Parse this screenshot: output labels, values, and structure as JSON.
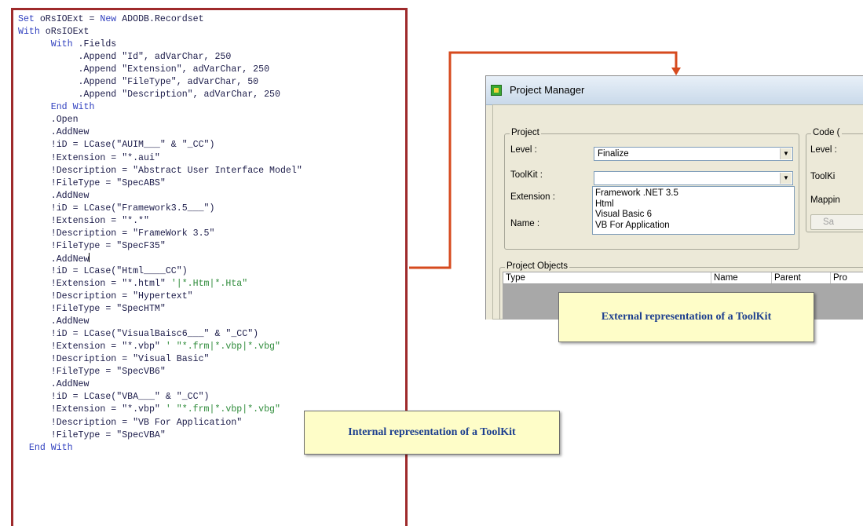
{
  "code": {
    "lines": [
      [
        {
          "t": "Set",
          "k": "kw"
        },
        {
          "t": " oRsIOExt = "
        },
        {
          "t": "New",
          "k": "kw"
        },
        {
          "t": " ADODB.Recordset"
        }
      ],
      [
        {
          "t": "With",
          "k": "kw"
        },
        {
          "t": " oRsIOExt"
        }
      ],
      [
        {
          "t": "      "
        },
        {
          "t": "With",
          "k": "kw"
        },
        {
          "t": " .Fields"
        }
      ],
      [
        {
          "t": "           .Append \"Id\", adVarChar, 250"
        }
      ],
      [
        {
          "t": "           .Append \"Extension\", adVarChar, 250"
        }
      ],
      [
        {
          "t": "           .Append \"FileType\", adVarChar, 50"
        }
      ],
      [
        {
          "t": "           .Append \"Description\", adVarChar, 250"
        }
      ],
      [
        {
          "t": "      "
        },
        {
          "t": "End With",
          "k": "kw"
        }
      ],
      [
        {
          "t": "      .Open"
        }
      ],
      [
        {
          "t": "      .AddNew"
        }
      ],
      [
        {
          "t": "      !iD = LCase(\"AUIM___\" & \"_CC\")"
        }
      ],
      [
        {
          "t": "      !Extension = \"*.aui\""
        }
      ],
      [
        {
          "t": "      !Description = \"Abstract User Interface Model\""
        }
      ],
      [
        {
          "t": "      !FileType = \"SpecABS\""
        }
      ],
      [
        {
          "t": "      .AddNew"
        }
      ],
      [
        {
          "t": "      !iD = LCase(\"Framework3.5___\")"
        }
      ],
      [
        {
          "t": "      !Extension = \"*.*\""
        }
      ],
      [
        {
          "t": "      !Description = \"FrameWork 3.5\""
        }
      ],
      [
        {
          "t": "      !FileType = \"SpecF35\""
        }
      ],
      [
        {
          "t": "      .AddNew",
          "caret": true
        }
      ],
      [
        {
          "t": "      !iD = LCase(\"Html____CC\")"
        }
      ],
      [
        {
          "t": "      !Extension = \"*.html\" "
        },
        {
          "t": "'|*.Htm|*.Hta\"",
          "k": "cm"
        }
      ],
      [
        {
          "t": "      !Description = \"Hypertext\""
        }
      ],
      [
        {
          "t": "      !FileType = \"SpecHTM\""
        }
      ],
      [
        {
          "t": "      .AddNew"
        }
      ],
      [
        {
          "t": "      !iD = LCase(\"VisualBaisc6___\" & \"_CC\")"
        }
      ],
      [
        {
          "t": "      !Extension = \"*.vbp\" "
        },
        {
          "t": "' \"*.frm|*.vbp|*.vbg\"",
          "k": "cm"
        }
      ],
      [
        {
          "t": "      !Description = \"Visual Basic\""
        }
      ],
      [
        {
          "t": "      !FileType = \"SpecVB6\""
        }
      ],
      [
        {
          "t": "      .AddNew"
        }
      ],
      [
        {
          "t": "      !iD = LCase(\"VBA___\" & \"_CC\")"
        }
      ],
      [
        {
          "t": "      !Extension = \"*.vbp\" "
        },
        {
          "t": "' \"*.frm|*.vbp|*.vbg\"",
          "k": "cm"
        }
      ],
      [
        {
          "t": "      !Description = \"VB For Application\""
        }
      ],
      [
        {
          "t": "      !FileType = \"SpecVBA\""
        }
      ],
      [
        {
          "t": "  "
        },
        {
          "t": "End With",
          "k": "kw"
        }
      ]
    ]
  },
  "project_manager": {
    "title": "Project Manager",
    "project_group": {
      "title": "Project",
      "level_label": "Level :",
      "level_value": "Finalize",
      "toolkit_label": "ToolKit :",
      "toolkit_value": "",
      "extension_label": "Extension :",
      "name_label": "Name :",
      "toolkit_options": [
        "Framework .NET 3.5",
        "Html",
        "Visual Basic 6",
        "VB For Application"
      ]
    },
    "code_group": {
      "title": "Code (",
      "level_label": "Level :",
      "toolkit_label": "ToolKi",
      "mapping_label": "Mappin",
      "save_label": "Sa"
    },
    "objects_group": {
      "title": "Project Objects",
      "columns": [
        "Type",
        "Name",
        "Parent",
        "Pro"
      ]
    }
  },
  "callouts": {
    "external": "External representation of a ToolKit",
    "internal": "Internal representation of a ToolKit"
  },
  "colors": {
    "code_border": "#9e2a2b",
    "connector": "#d64a1e",
    "keyword": "#2f3fbf",
    "comment": "#2e8b3a",
    "callout_bg": "#fefdc8",
    "callout_text": "#1d3f8f"
  }
}
